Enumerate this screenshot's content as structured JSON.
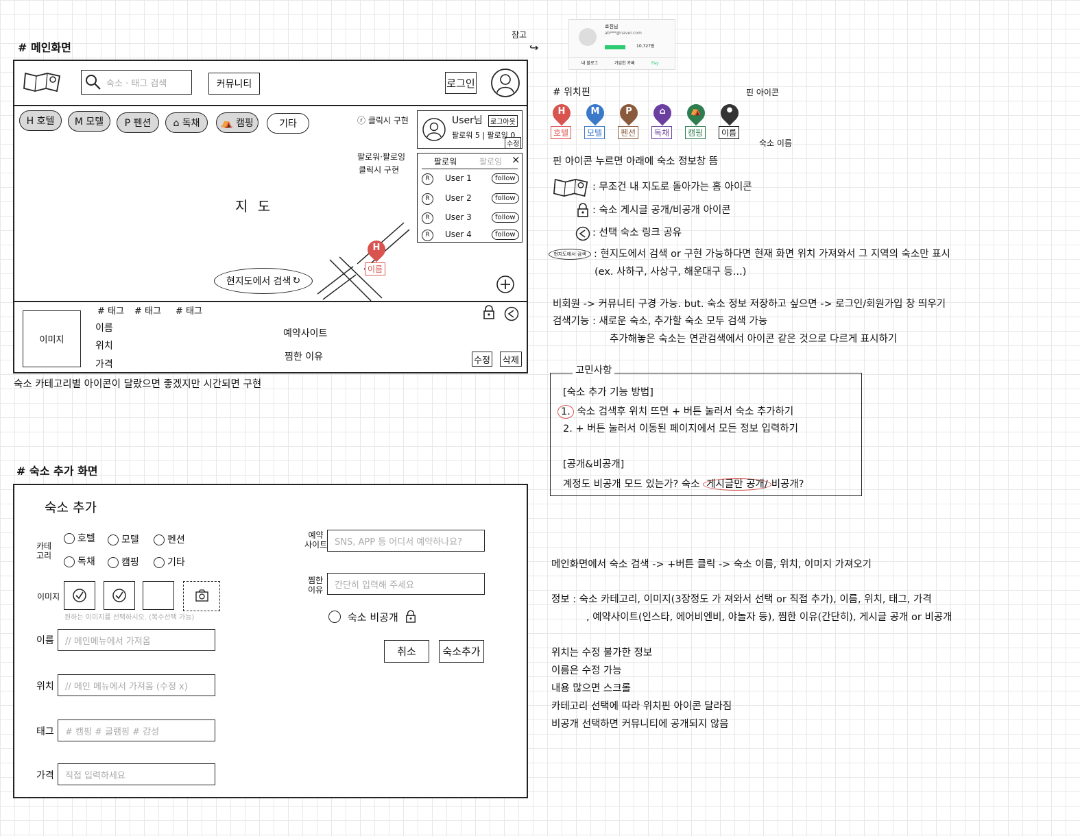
{
  "main_screen": {
    "section_title": "# 메인화면",
    "search_placeholder": "숙소 · 태그 검색",
    "community_button": "커뮤니티",
    "login_button": "로그인",
    "categories": [
      "H 호텔",
      "M 모텔",
      "P 펜션",
      "⌂ 독채",
      "⛺ 캠핑",
      "기타"
    ],
    "map_label": "지 도",
    "annotation_click": "ⓡ 클릭시 구현",
    "annotation_follow_line1": "팔로워·팔로잉",
    "annotation_follow_line2": "클릭시 구현",
    "user_card": {
      "name": "User님",
      "logout": "로그아웃",
      "stats": "팔로워 5 | 팔로잉 0",
      "edit": "수정"
    },
    "follow_panel": {
      "tab_followers": "팔로워",
      "tab_following": "팔로잉",
      "close": "×",
      "users": [
        "User 1",
        "User 2",
        "User 3",
        "User 4"
      ],
      "follow_label": "follow"
    },
    "marker_label": "이름",
    "search_here_button": "현지도에서 검색",
    "detail": {
      "image_label": "이미지",
      "tags": [
        "# 태그",
        "# 태그",
        "# 태그"
      ],
      "name_label": "이름",
      "location_label": "위치",
      "price_label": "가격",
      "booking_site_label": "예약사이트",
      "reason_label": "찜한 이유",
      "edit_button": "수정",
      "delete_button": "삭제"
    },
    "footnote": "숙소 카테고리별 아이콘이 달랐으면 좋겠지만 시간되면 구현"
  },
  "reference": {
    "label": "참고",
    "profile": {
      "name": "효진님",
      "email": "ab***@naver.com",
      "blog": "내 블로그",
      "cafe": "가입한 카페",
      "pay": "Pay",
      "points": "10,727원"
    }
  },
  "pins": {
    "title": "# 위치핀",
    "pin_icon_note": "핀 아이콘",
    "name_note": "숙소 이름",
    "items": [
      {
        "letter": "H",
        "label": "호텔",
        "color": "#d9534f"
      },
      {
        "letter": "M",
        "label": "모텔",
        "color": "#3a78c9"
      },
      {
        "letter": "P",
        "label": "펜션",
        "color": "#8a5a3c"
      },
      {
        "letter": "⌂",
        "label": "독채",
        "color": "#6a3fa0"
      },
      {
        "letter": "⛺",
        "label": "캠핑",
        "color": "#2e7d4f"
      },
      {
        "letter": "●",
        "label": "이름",
        "color": "#333333"
      }
    ]
  },
  "notes": {
    "pin_click": "핀 아이콘 누르면 아래에 숙소 정보창 뜸",
    "home_icon": ": 무조건 내 지도로 돌아가는 홈 아이콘",
    "lock_icon": ": 숙소 게시글 공개/비공개 아이콘",
    "share_icon": ": 선택 숙소 링크 공유",
    "search_here_mini": "현지도에서 검색",
    "search_here_note": ": 현지도에서 검색 or 구현 가능하다면 현재 화면 위치 가져와서 그 지역의 숙소만 표시",
    "search_here_example": "(ex. 사하구, 사상구, 해운대구 등...)",
    "member_note": "비회원 -> 커뮤니티 구경 가능. but. 숙소 정보 저장하고 싶으면 -> 로그인/회원가입 창 띄우기",
    "search_note1": "검색기능 : 새로운 숙소, 추가할 숙소 모두 검색 가능",
    "search_note2": "추가해놓은 숙소는 연관검색에서 아이콘 같은 것으로 다르게 표시하기"
  },
  "concerns": {
    "title": "고민사항",
    "heading1": "[숙소 추가 기능 방법]",
    "item1_num": "1.",
    "item1": "숙소 검색후 위치 뜨면 + 버튼 눌러서 숙소 추가하기",
    "item2": "2. + 버튼 눌러서 이동된 페이지에서 모든 정보 입력하기",
    "heading2": "[공개&비공개]",
    "q_before": "계정도 비공개 모드 있는가? 숙소 ",
    "q_circled": "게시글만 공개/",
    "q_after": "비공개?"
  },
  "add_screen": {
    "section_title": "# 숙소 추가 화면",
    "title": "숙소 추가",
    "category_label": "카테\n고리",
    "category_options": [
      "호텔",
      "모텔",
      "펜션",
      "독채",
      "캠핑",
      "기타"
    ],
    "image_label": "이미지",
    "image_hint": "원하는 이미지를 선택하시오. (복수선택 가능)",
    "name_label": "이름",
    "name_placeholder": "// 메인메뉴에서 가져옴",
    "location_label": "위치",
    "location_placeholder": "// 메인 메뉴에서 가져옴 (수정 x)",
    "tag_label": "태그",
    "tag_placeholder": "# 캠핑 # 글램핑 # 감성",
    "price_label": "가격",
    "price_placeholder": "직접 입력하세요",
    "booking_label": "예약\n사이트",
    "booking_placeholder": "SNS, APP 등 어디서 예약하나요?",
    "reason_label": "찜한\n이유",
    "reason_placeholder": "간단히 입력해 주세요",
    "private_label": "숙소 비공개",
    "cancel_button": "취소",
    "add_button": "숙소추가"
  },
  "bottom_notes": [
    "메인화면에서 숙소 검색 -> +버튼 클릭 -> 숙소 이름, 위치, 이미지 가져오기",
    "정보 : 숙소 카테고리, 이미지(3장정도 가 져와서 선택 or 직접 추가), 이름, 위치, 태그, 가격",
    ", 예약사이트(인스타, 에어비엔비, 야놀자 등), 찜한 이유(간단히), 게시글 공개 or 비공개",
    "위치는 수정 불가한 정보",
    "이름은 수정 가능",
    "내용 많으면 스크롤",
    "카테고리 선택에 따라 위치핀 아이콘 달라짐",
    "비공개 선택하면 커뮤니티에 공개되지 않음"
  ]
}
